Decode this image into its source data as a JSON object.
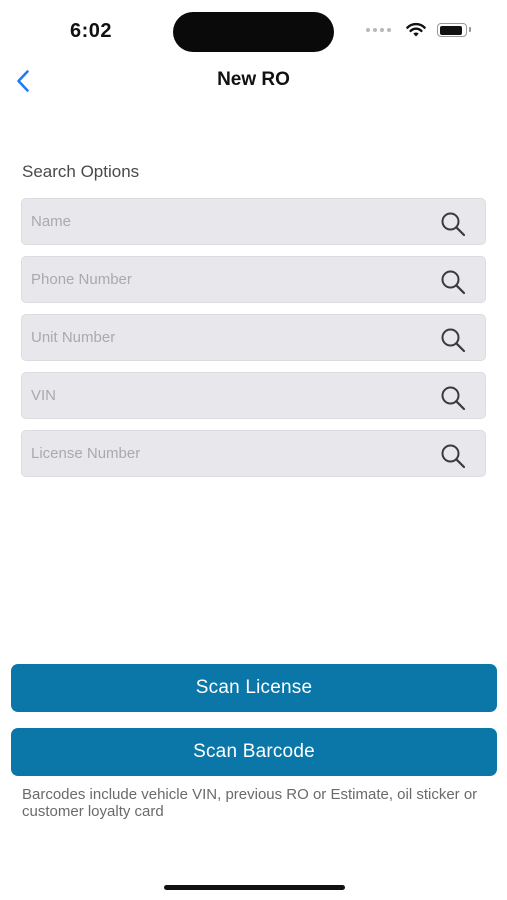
{
  "status_bar": {
    "time": "6:02",
    "battery_level": 0.9,
    "icons": [
      "signal-dots-icon",
      "wifi-icon",
      "battery-icon"
    ]
  },
  "nav": {
    "title": "New RO",
    "back_icon": "chevron-left-icon"
  },
  "search": {
    "section_label": "Search Options",
    "fields": [
      {
        "placeholder": "Name",
        "value": ""
      },
      {
        "placeholder": "Phone Number",
        "value": ""
      },
      {
        "placeholder": "Unit Number",
        "value": ""
      },
      {
        "placeholder": "VIN",
        "value": ""
      },
      {
        "placeholder": "License Number",
        "value": ""
      }
    ],
    "icon": "magnifying-glass-icon"
  },
  "actions": {
    "scan_license_label": "Scan License",
    "scan_barcode_label": "Scan Barcode",
    "hint": "Barcodes include vehicle VIN, previous RO or Estimate, oil sticker or customer loyalty card"
  },
  "colors": {
    "accent": "#0A77A8",
    "back_tint": "#1E7CF2",
    "field_bg": "#E8E8EC"
  }
}
